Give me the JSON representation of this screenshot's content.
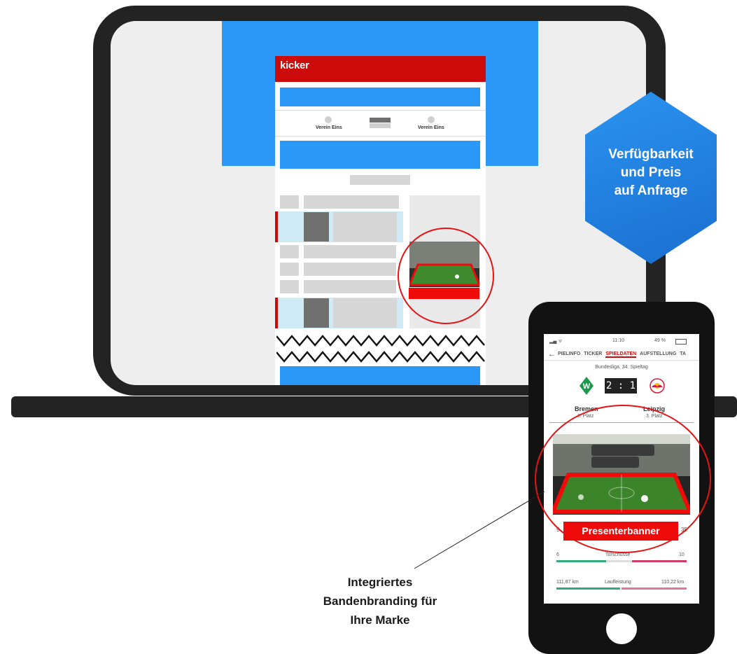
{
  "kicker": {
    "logo": "kicker",
    "team_left": "Verein Eins",
    "team_right": "Verein Eins"
  },
  "phone": {
    "status_time": "11:10",
    "status_battery": "49 %",
    "tabs": [
      "PIELINFO",
      "TICKER",
      "SPIELDATEN",
      "AUFSTELLUNG",
      "TA"
    ],
    "active_tab": "SPIELDATEN",
    "league": "Bundesliga, 34. Spieltag",
    "score": "2 : 1",
    "home_team": "Bremen",
    "home_place": "8. Platz",
    "away_team": "Leipzig",
    "away_place": "3. Platz",
    "stat_left_partial": "9",
    "stat_right_partial": "35",
    "stats": [
      {
        "left": "6",
        "label": "Torschüsse",
        "right": "10"
      },
      {
        "left": "111,87 km",
        "label": "Laufleistung",
        "right": "110,22 km"
      }
    ]
  },
  "hexagon_text": "Verfügbarkeit\nund Preis\nauf Anfrage",
  "presenter_banner": "Presenterbanner",
  "callout": "Integriertes\nBandenbranding für\nIhre Marke",
  "colors": {
    "accent_red": "#f00b0b",
    "kicker_red": "#cc0a0a",
    "ad_blue": "#2b97f7",
    "hex_blue": "#1a7ee0",
    "device": "#232323"
  }
}
